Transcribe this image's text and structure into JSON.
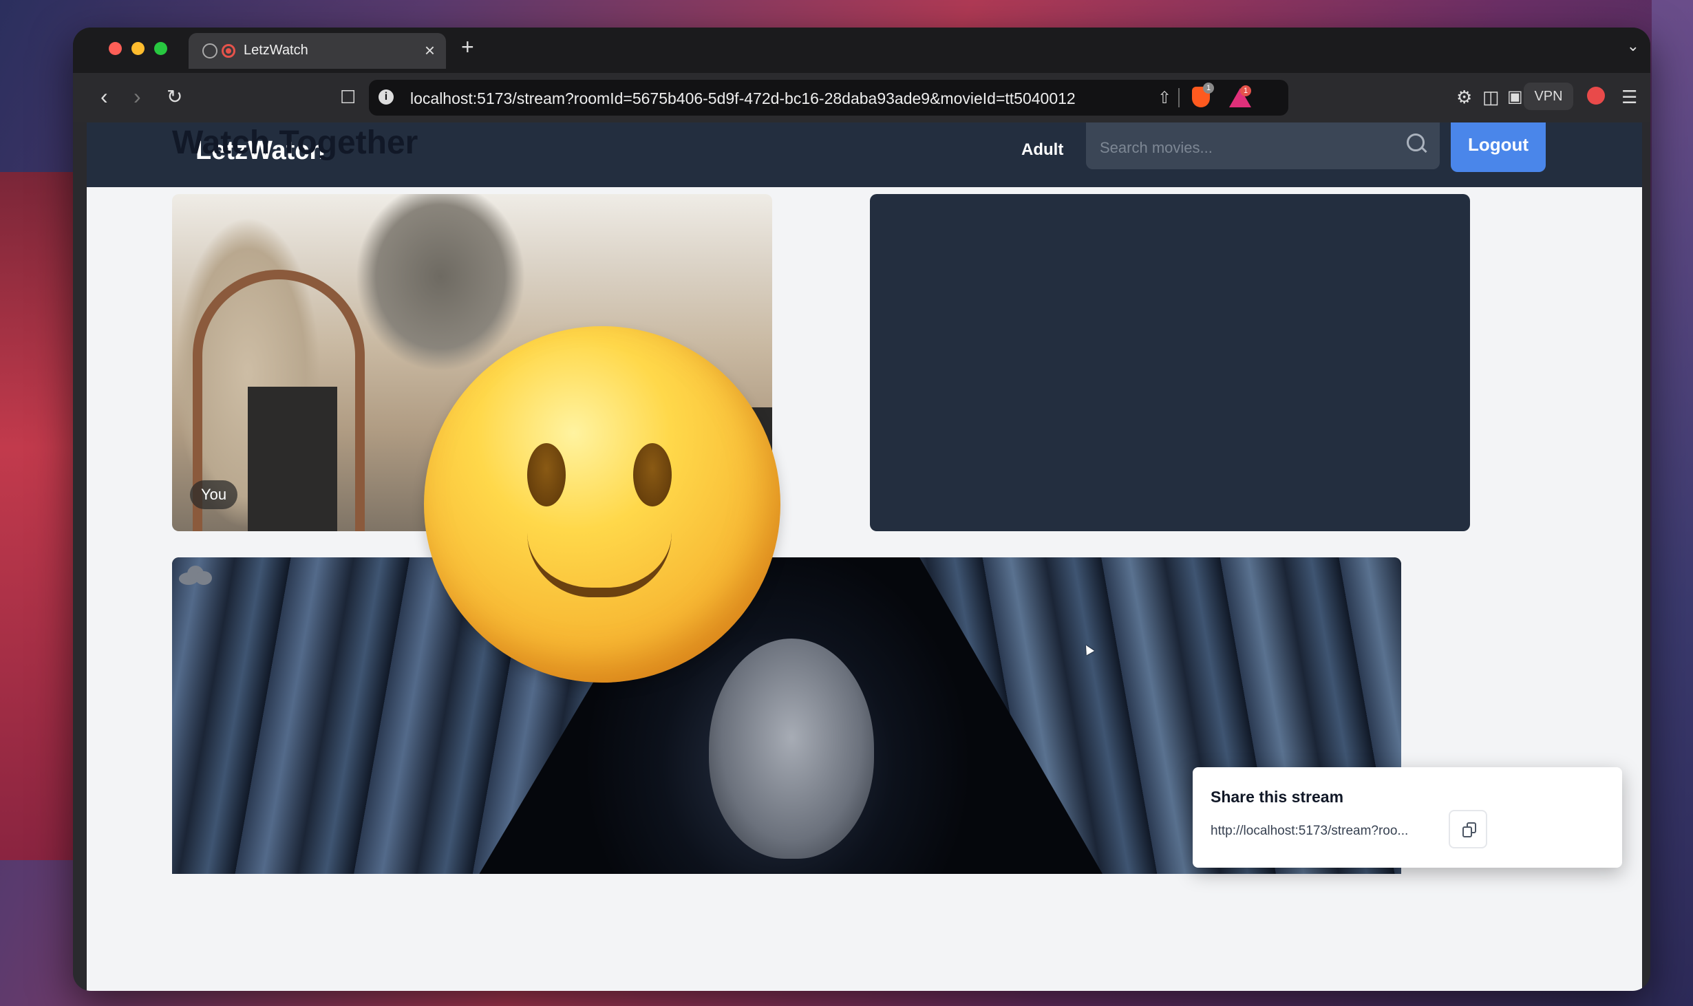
{
  "browser": {
    "tab_title": "LetzWatch",
    "new_tab": "+",
    "close_tab": "×",
    "url": "localhost:5173/stream?roomId=5675b406-5d9f-472d-bc16-28daba93ade9&movieId=tt5040012",
    "brave_badge": "1",
    "alert_badge": "1",
    "vpn_label": "VPN"
  },
  "app": {
    "brand": "LetzWatch",
    "nav_adult": "Adult",
    "search_placeholder": "Search movies...",
    "logout": "Logout"
  },
  "page": {
    "title": "Watch Together",
    "local_video_label": "You"
  },
  "share": {
    "title": "Share this stream",
    "url": "http://localhost:5173/stream?roo..."
  },
  "colors": {
    "header": "#232e3f",
    "accent": "#4a86ea",
    "page_bg": "#f3f4f6"
  }
}
